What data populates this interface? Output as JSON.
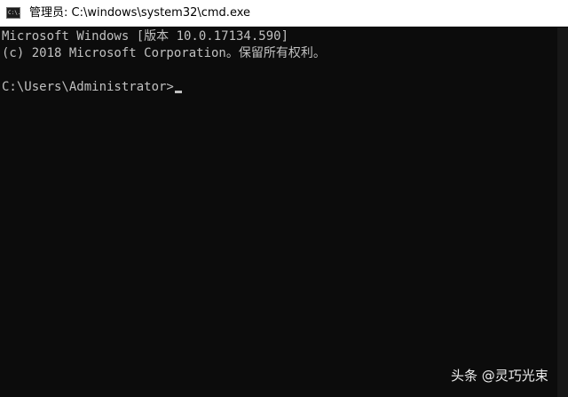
{
  "window": {
    "icon_text": "C:\\.",
    "title": "管理员: C:\\windows\\system32\\cmd.exe"
  },
  "console": {
    "lines": [
      "Microsoft Windows [版本 10.0.17134.590]",
      "(c) 2018 Microsoft Corporation。保留所有权利。",
      "",
      "C:\\Users\\Administrator>"
    ]
  },
  "watermark": "头条 @灵巧光束",
  "colors": {
    "console_background": "#0c0c0c",
    "console_text": "#c0c0c0",
    "titlebar_background": "#ffffff"
  }
}
